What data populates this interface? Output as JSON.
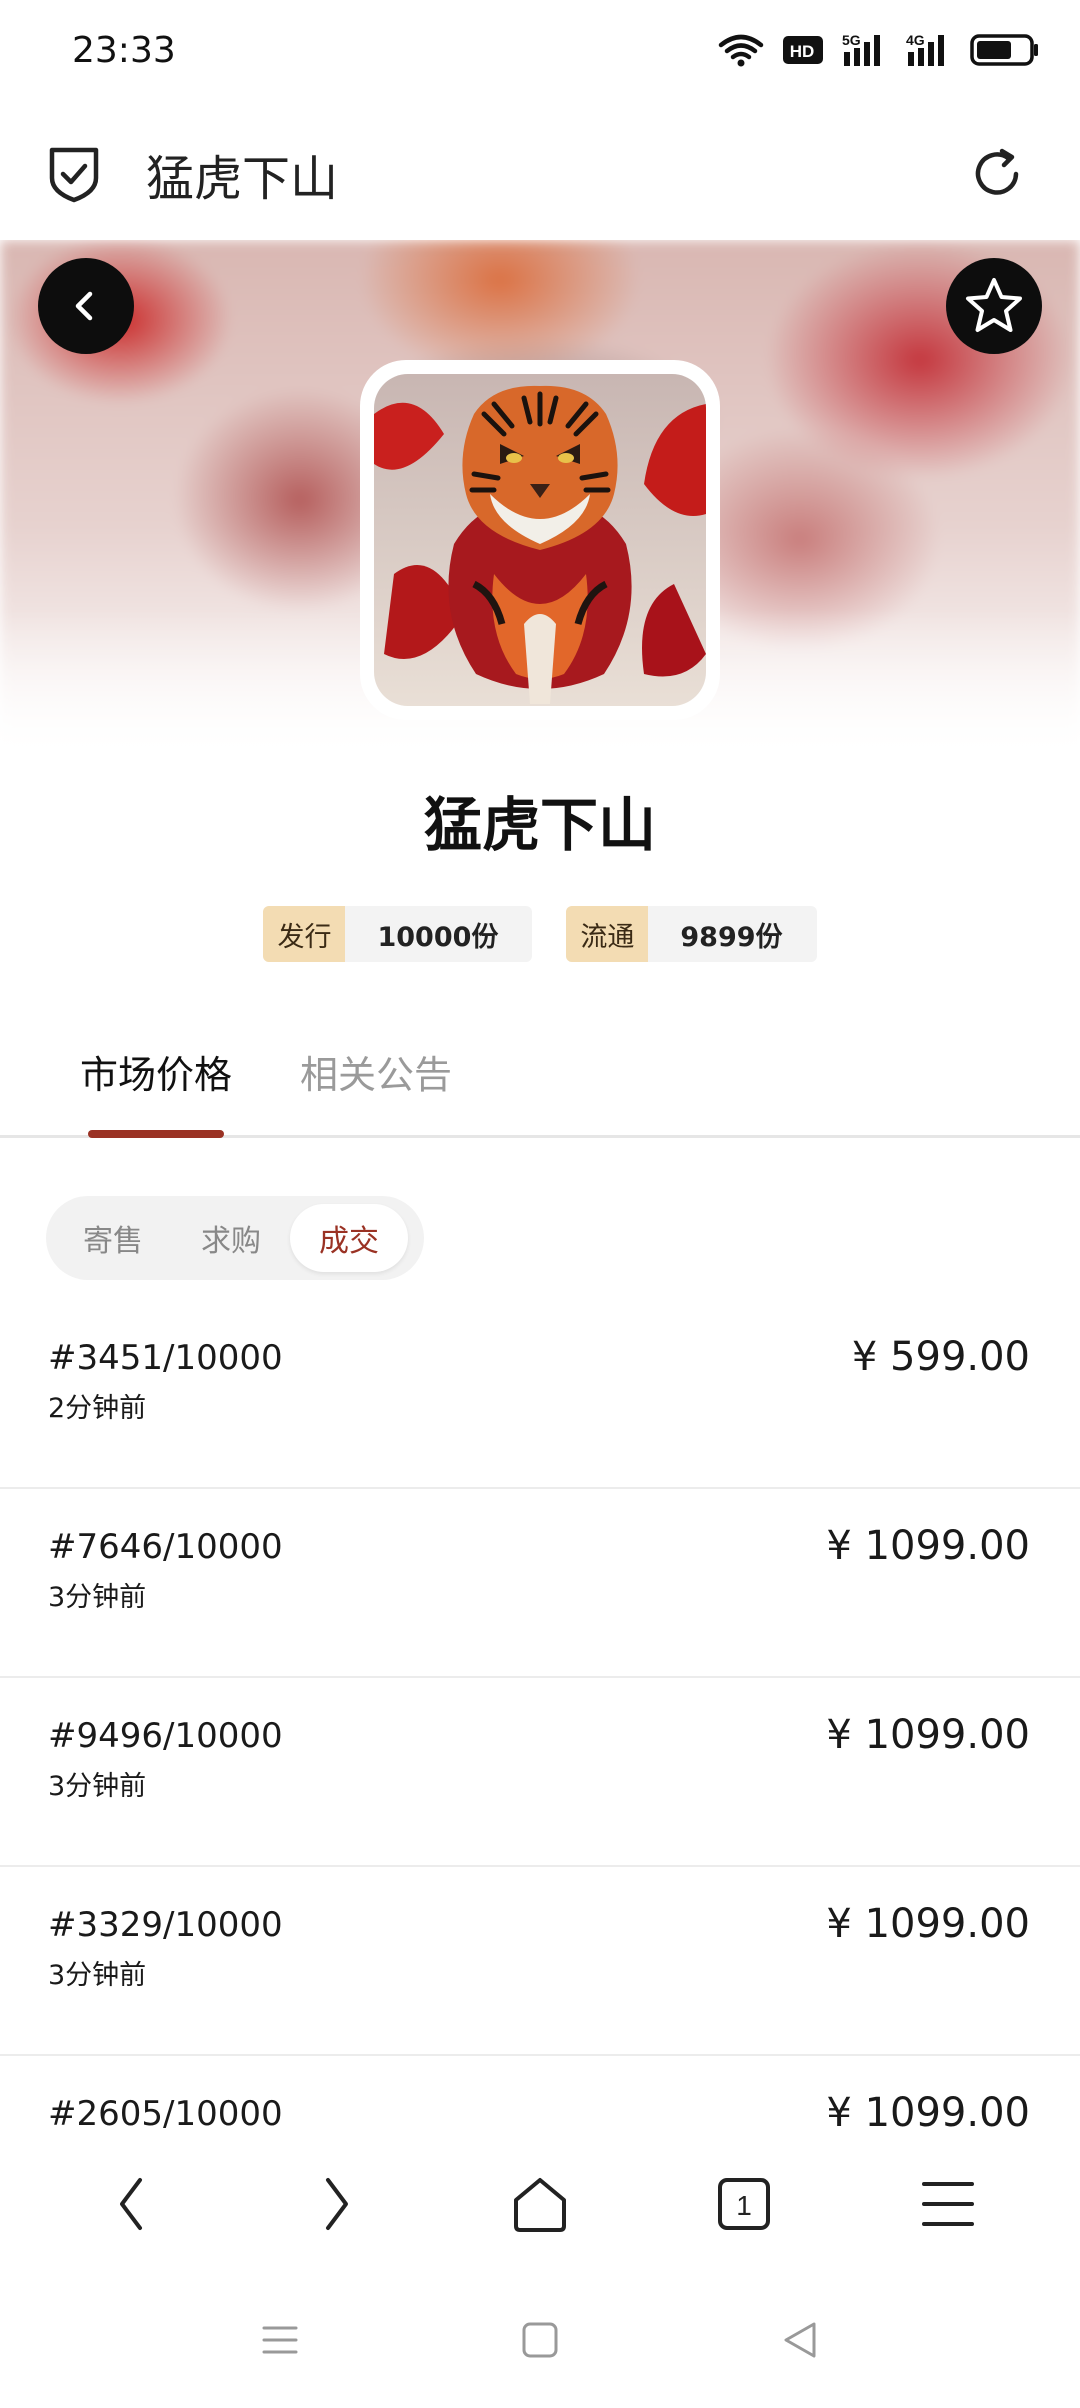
{
  "status_bar": {
    "time": "23:33",
    "icons": [
      "wifi-icon",
      "hd-icon",
      "5g-signal-icon",
      "4g-signal-icon",
      "battery-icon"
    ],
    "hd_label": "HD",
    "net1_label": "5G",
    "net2_label": "4G"
  },
  "header": {
    "title": "猛虎下山"
  },
  "collection": {
    "name": "猛虎下山",
    "stats": [
      {
        "label": "发行",
        "value": "10000份"
      },
      {
        "label": "流通",
        "value": "9899份"
      }
    ]
  },
  "tabs": [
    {
      "label": "市场价格",
      "active": true
    },
    {
      "label": "相关公告",
      "active": false
    }
  ],
  "filter": [
    {
      "label": "寄售",
      "active": false
    },
    {
      "label": "求购",
      "active": false
    },
    {
      "label": "成交",
      "active": true
    }
  ],
  "trades": [
    {
      "serial": "#3451/10000",
      "time": "2分钟前",
      "price": "¥ 599.00"
    },
    {
      "serial": "#7646/10000",
      "time": "3分钟前",
      "price": "¥ 1099.00"
    },
    {
      "serial": "#9496/10000",
      "time": "3分钟前",
      "price": "¥ 1099.00"
    },
    {
      "serial": "#3329/10000",
      "time": "3分钟前",
      "price": "¥ 1099.00"
    },
    {
      "serial": "#2605/10000",
      "time": "",
      "price": "¥ 1099.00"
    }
  ],
  "toolbar": {
    "tab_count": "1"
  },
  "colors": {
    "accent": "#9a3224",
    "badge_bg": "#f3dcb3",
    "chip_bg": "#f3f3f3"
  }
}
